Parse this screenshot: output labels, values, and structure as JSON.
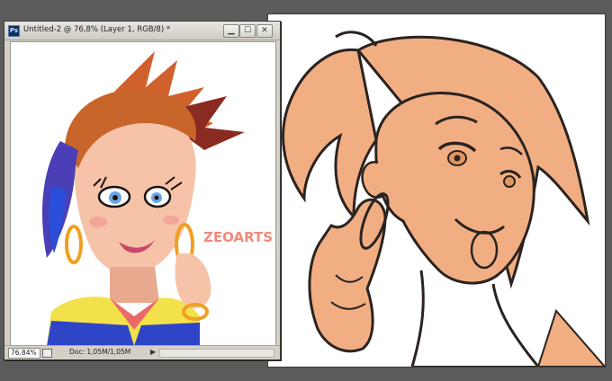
{
  "document_window": {
    "app_icon_label": "Ps",
    "title": "Untitled-2 @ 76,8% (Layer 1, RGB/8) *",
    "buttons": {
      "minimize": "▁",
      "maximize": "☐",
      "close": "✕"
    },
    "status": {
      "zoom": "76.84%",
      "doc_info": "Doc: 1,05M/1,05M",
      "arrow": "▶"
    }
  },
  "artwork": {
    "signature": "ZEOARTS"
  },
  "colors": {
    "workspace": "#5b5b5b",
    "skin": "#f2ae83",
    "line": "#2a2320",
    "hair_color": "#c8652a"
  }
}
